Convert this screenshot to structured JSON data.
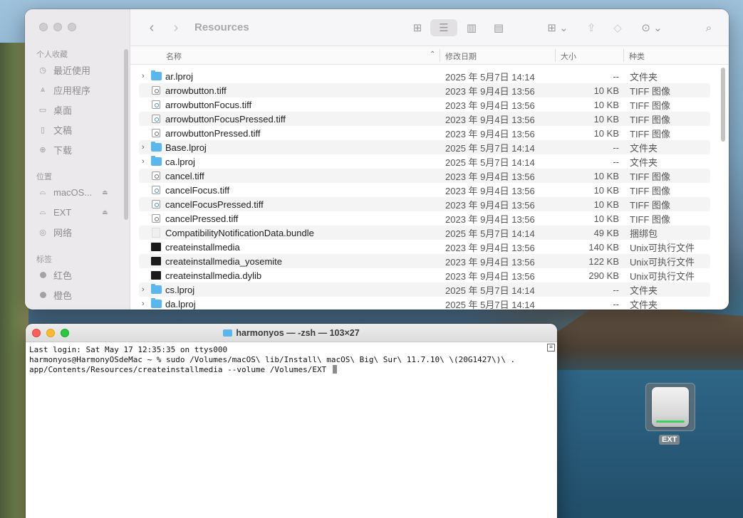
{
  "finder": {
    "title": "Resources",
    "sidebar": {
      "sections": [
        {
          "label": "个人收藏",
          "items": [
            {
              "label": "最近使用",
              "icon": "clock-icon"
            },
            {
              "label": "应用程序",
              "icon": "apps-icon"
            },
            {
              "label": "桌面",
              "icon": "desktop-icon"
            },
            {
              "label": "文稿",
              "icon": "document-icon"
            },
            {
              "label": "下载",
              "icon": "download-icon"
            }
          ]
        },
        {
          "label": "位置",
          "items": [
            {
              "label": "macOS...",
              "icon": "disk-icon"
            },
            {
              "label": "EXT",
              "icon": "disk-icon"
            },
            {
              "label": "网络",
              "icon": "globe-icon"
            }
          ]
        },
        {
          "label": "标签",
          "items": [
            {
              "label": "红色",
              "icon": "tag-dot-icon"
            },
            {
              "label": "橙色",
              "icon": "tag-dot-icon"
            }
          ]
        }
      ]
    },
    "columns": {
      "name": "名称",
      "date": "修改日期",
      "size": "大小",
      "kind": "种类"
    },
    "files": [
      {
        "name": "ar.lproj",
        "date": "2025 年 5月7日 14:14",
        "size": "--",
        "kind": "文件夹",
        "type": "folder"
      },
      {
        "name": "arrowbutton.tiff",
        "date": "2023 年 9月4日 13:56",
        "size": "10 KB",
        "kind": "TIFF 图像",
        "type": "tiff"
      },
      {
        "name": "arrowbuttonFocus.tiff",
        "date": "2023 年 9月4日 13:56",
        "size": "10 KB",
        "kind": "TIFF 图像",
        "type": "tiff-blue"
      },
      {
        "name": "arrowbuttonFocusPressed.tiff",
        "date": "2023 年 9月4日 13:56",
        "size": "10 KB",
        "kind": "TIFF 图像",
        "type": "tiff-blue"
      },
      {
        "name": "arrowbuttonPressed.tiff",
        "date": "2023 年 9月4日 13:56",
        "size": "10 KB",
        "kind": "TIFF 图像",
        "type": "tiff"
      },
      {
        "name": "Base.lproj",
        "date": "2025 年 5月7日 14:14",
        "size": "--",
        "kind": "文件夹",
        "type": "folder"
      },
      {
        "name": "ca.lproj",
        "date": "2025 年 5月7日 14:14",
        "size": "--",
        "kind": "文件夹",
        "type": "folder"
      },
      {
        "name": "cancel.tiff",
        "date": "2023 年 9月4日 13:56",
        "size": "10 KB",
        "kind": "TIFF 图像",
        "type": "tiff"
      },
      {
        "name": "cancelFocus.tiff",
        "date": "2023 年 9月4日 13:56",
        "size": "10 KB",
        "kind": "TIFF 图像",
        "type": "tiff-blue"
      },
      {
        "name": "cancelFocusPressed.tiff",
        "date": "2023 年 9月4日 13:56",
        "size": "10 KB",
        "kind": "TIFF 图像",
        "type": "tiff-blue"
      },
      {
        "name": "cancelPressed.tiff",
        "date": "2023 年 9月4日 13:56",
        "size": "10 KB",
        "kind": "TIFF 图像",
        "type": "tiff"
      },
      {
        "name": "CompatibilityNotificationData.bundle",
        "date": "2025 年 5月7日 14:14",
        "size": "49 KB",
        "kind": "捆绑包",
        "type": "bundle"
      },
      {
        "name": "createinstallmedia",
        "date": "2023 年 9月4日 13:56",
        "size": "140 KB",
        "kind": "Unix可执行文件",
        "type": "exec"
      },
      {
        "name": "createinstallmedia_yosemite",
        "date": "2023 年 9月4日 13:56",
        "size": "122 KB",
        "kind": "Unix可执行文件",
        "type": "exec"
      },
      {
        "name": "createinstallmedia.dylib",
        "date": "2023 年 9月4日 13:56",
        "size": "290 KB",
        "kind": "Unix可执行文件",
        "type": "exec"
      },
      {
        "name": "cs.lproj",
        "date": "2025 年 5月7日 14:14",
        "size": "--",
        "kind": "文件夹",
        "type": "folder"
      },
      {
        "name": "da.lproj",
        "date": "2025 年 5月7日 14:14",
        "size": "--",
        "kind": "文件夹",
        "type": "folder"
      }
    ]
  },
  "terminal": {
    "title": "harmonyos — -zsh — 103×27",
    "line1": "Last login: Sat May 17 12:35:35 on ttys000",
    "line2": "harmonyos@HarmonyOSdeMac ~ % sudo /Volumes/macOS\\ lib/Install\\ macOS\\ Big\\ Sur\\ 11.7.10\\ \\(20G1427\\)\\ .",
    "line3": "app/Contents/Resources/createinstallmedia --volume /Volumes/EXT "
  },
  "desktop": {
    "drive_label": "EXT"
  }
}
